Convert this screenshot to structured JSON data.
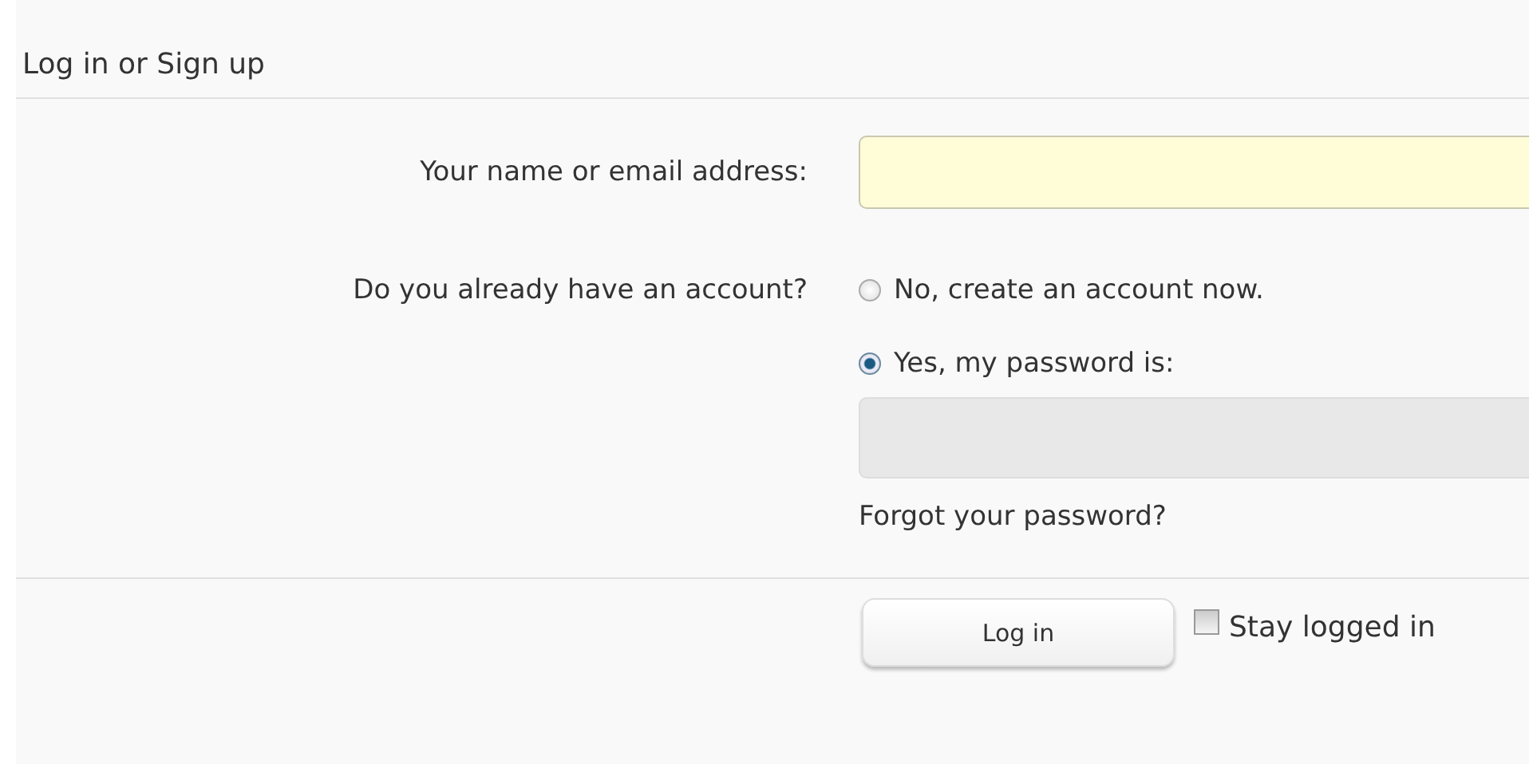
{
  "title": "Log in or Sign up",
  "name_field": {
    "label": "Your name or email address:"
  },
  "account": {
    "label": "Do you already have an account?",
    "options": [
      {
        "label": "No, create an account now.",
        "selected": false
      },
      {
        "label": "Yes, my password is:",
        "selected": true
      }
    ]
  },
  "password_field": {
    "disabled": true
  },
  "forgot_link": "Forgot your password?",
  "login_button": "Log in",
  "stay_logged_in": {
    "label": "Stay logged in",
    "checked": false
  }
}
